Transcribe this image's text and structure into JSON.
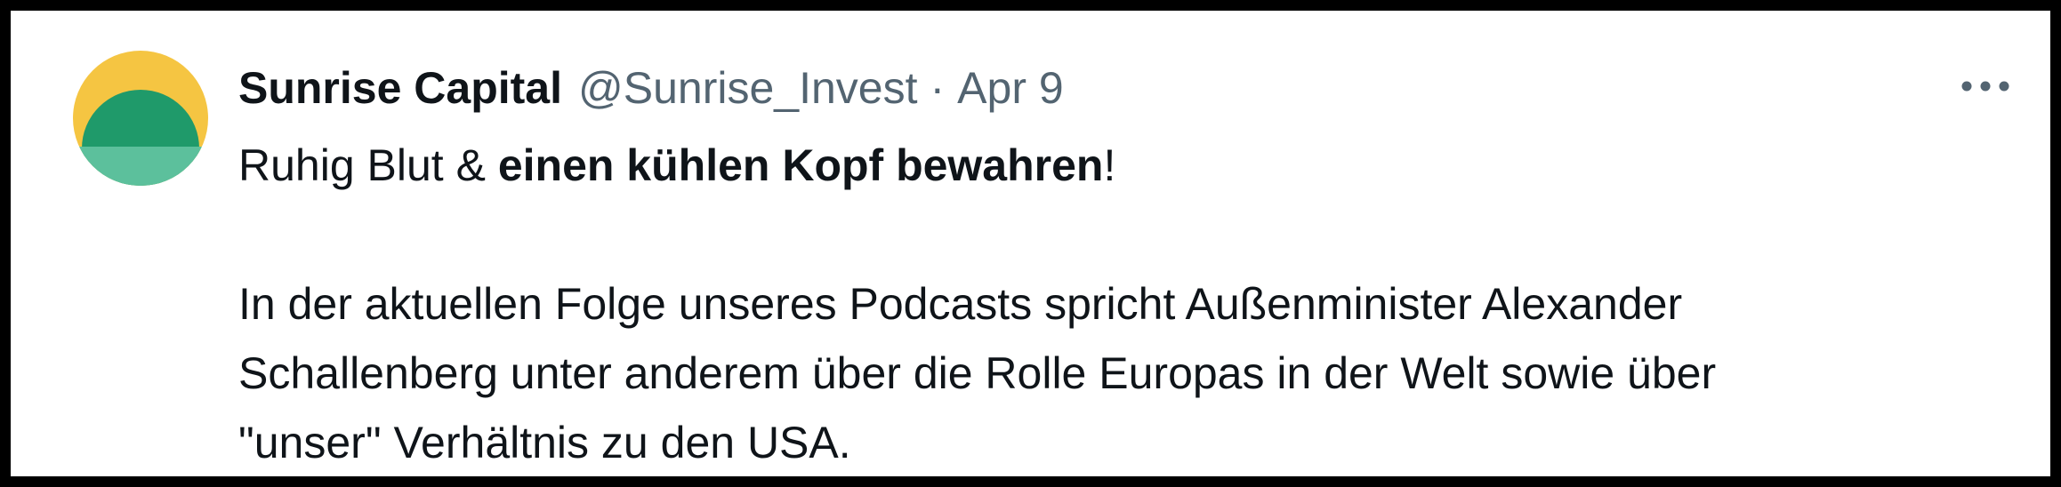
{
  "tweet": {
    "author_name": "Sunrise Capital",
    "handle": "@Sunrise_Invest",
    "separator": "·",
    "date": "Apr 9",
    "text": {
      "line1_normal": "Ruhig Blut & ",
      "line1_bold": "einen kühlen Kopf bewahren",
      "line1_end": "!",
      "paragraph2_line1": "In der aktuellen Folge unseres Podcasts spricht Außenminister Alexander",
      "paragraph2_line2": "Schallenberg unter anderem über die Rolle Europas in der Welt sowie über",
      "paragraph2_line3": "\"unser\" Verhältnis zu den USA."
    }
  },
  "icons": {
    "avatar": "sunrise-logo",
    "more": "more-dots-icon"
  },
  "colors": {
    "text_primary": "#0f1419",
    "text_secondary": "#536471",
    "logo_yellow": "#f5c542",
    "logo_green": "#1f9a6a",
    "logo_teal": "#5cc09c",
    "frame_border": "#000000"
  }
}
